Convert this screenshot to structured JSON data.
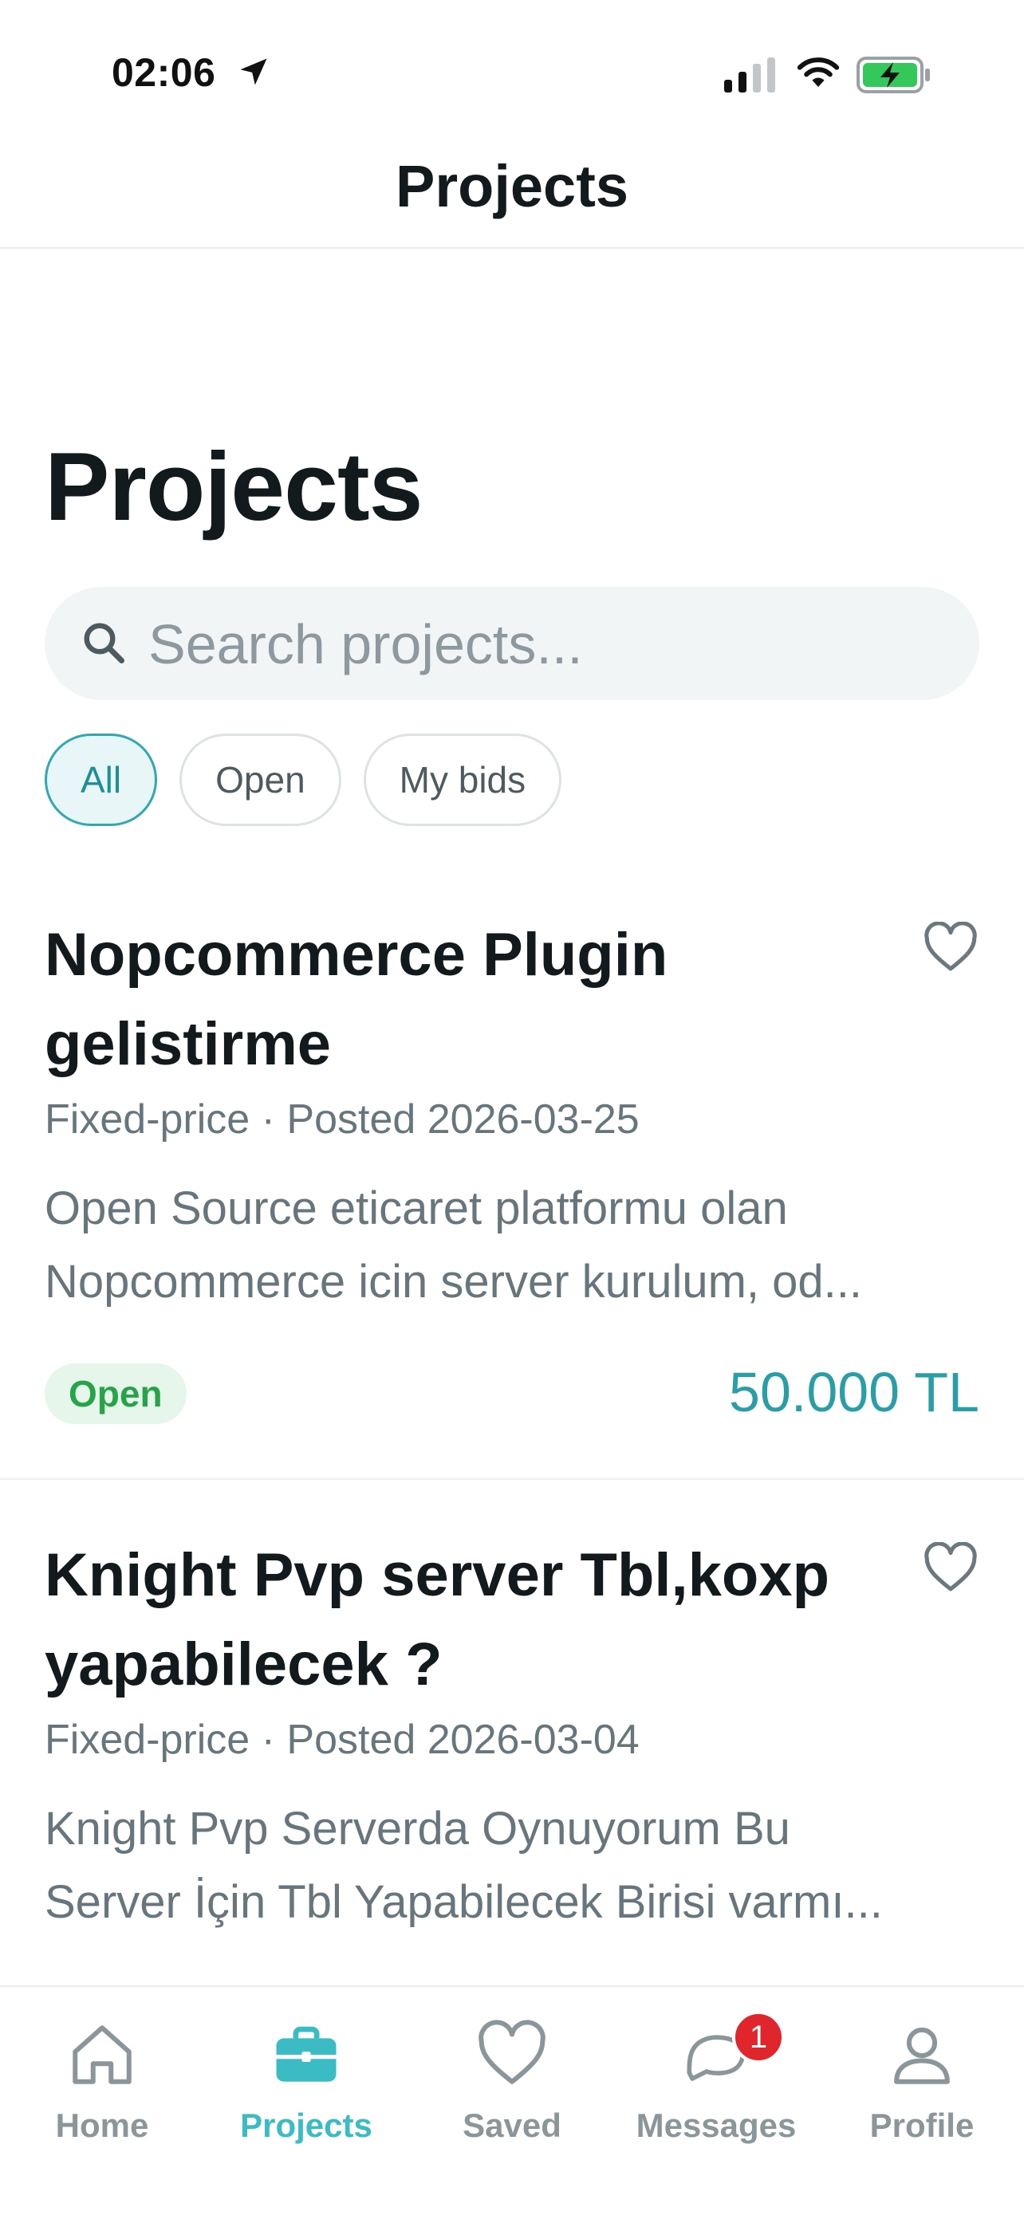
{
  "status_bar": {
    "time": "02:06"
  },
  "nav": {
    "title": "Projects"
  },
  "page": {
    "title": "Projects"
  },
  "search": {
    "placeholder": "Search projects..."
  },
  "filters": [
    {
      "label": "All",
      "selected": true
    },
    {
      "label": "Open",
      "selected": false
    },
    {
      "label": "My bids",
      "selected": false
    }
  ],
  "projects": [
    {
      "title_line1": "Nopcommerce Plugin",
      "title_line2": "gelistirme",
      "meta": "Fixed-price · Posted 2026-03-25",
      "desc_line1": "Open Source eticaret platformu olan",
      "desc_line2": "Nopcommerce icin server kurulum, od...",
      "status": "Open",
      "price": "50.000 TL"
    },
    {
      "title_line1": "Knight Pvp server Tbl,koxp",
      "title_line2": "yapabilecek ?",
      "meta": "Fixed-price · Posted 2026-03-04",
      "desc_line1": "Knight Pvp Serverda Oynuyorum Bu",
      "desc_line2": "Server İçin Tbl Yapabilecek Birisi varmı...",
      "status": "",
      "price": ""
    }
  ],
  "tabbar": [
    {
      "label": "Home",
      "icon": "home-icon"
    },
    {
      "label": "Projects",
      "icon": "briefcase-icon",
      "active": true
    },
    {
      "label": "Saved",
      "icon": "heart-icon"
    },
    {
      "label": "Messages",
      "icon": "chat-icon",
      "badge": "1"
    },
    {
      "label": "Profile",
      "icon": "person-icon"
    }
  ],
  "colors": {
    "accent": "#3bbcc4",
    "price": "#2a9ea7",
    "open_badge_bg": "#e6f6ea",
    "open_badge_text": "#27a349",
    "notification": "#e0262c"
  }
}
